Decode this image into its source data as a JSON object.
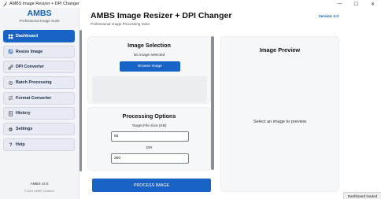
{
  "window": {
    "title": "AMBS Image Resizer + DPI Changer",
    "controls": {
      "minimize": "—",
      "maximize": "☐",
      "close": "✕"
    }
  },
  "sidebar": {
    "brand": "AMBS",
    "tagline": "Professional Image Suite",
    "items": [
      {
        "label": "Dashboard",
        "icon": "grid-icon",
        "active": true
      },
      {
        "label": "Resize Image",
        "icon": "resize-icon",
        "active": false
      },
      {
        "label": "DPI Converter",
        "icon": "link-icon",
        "active": false
      },
      {
        "label": "Batch Processing",
        "icon": "gear-icon",
        "active": false
      },
      {
        "label": "Format Converter",
        "icon": "convert-icon",
        "active": false
      },
      {
        "label": "History",
        "icon": "history-icon",
        "active": false
      },
      {
        "label": "Settings",
        "icon": "settings-icon",
        "active": false
      },
      {
        "label": "Help",
        "icon": "help-icon",
        "active": false
      }
    ],
    "version": "AMBS v2.0",
    "copyright": "© 2024 AMBS Solutions"
  },
  "header": {
    "title": "AMBS Image Resizer + DPI Changer",
    "subtitle": "Professional Image Processing Suite",
    "version": "Version 2.0"
  },
  "image_selection": {
    "title": "Image Selection",
    "status": "No image selected",
    "browse_label": "Browse Image"
  },
  "processing": {
    "title": "Processing Options",
    "target_label": "Target File Size (KB)",
    "target_value": "65",
    "dpi_label": "DPI",
    "dpi_value": "300"
  },
  "process_button": "PROCESS IMAGE",
  "preview": {
    "title": "Image Preview",
    "placeholder": "Select an image to preview"
  },
  "status_bar": "Dashboard loaded",
  "colors": {
    "accent": "#1a63c6",
    "brand": "#0f5fb5",
    "sidebar_bg": "#f3f4f8",
    "card_bg": "#f6f7f9"
  }
}
